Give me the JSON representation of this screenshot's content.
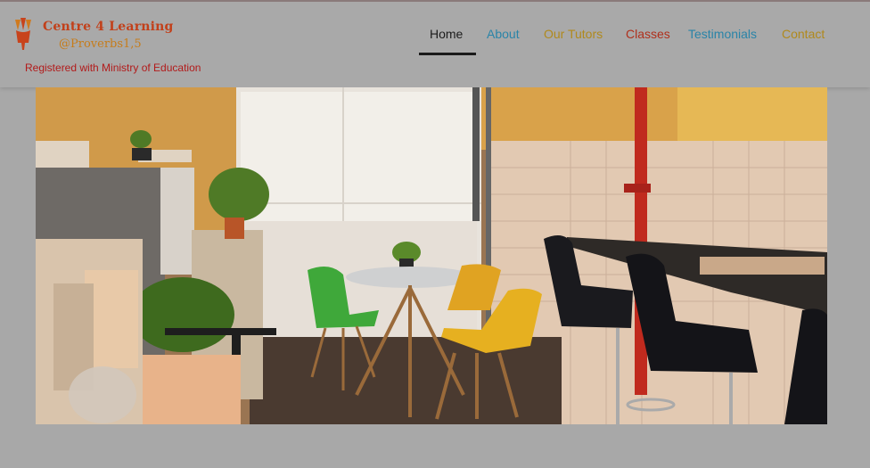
{
  "brand": {
    "name": "Centre 4 Learning",
    "tagline": "@Proverbs1,5",
    "registration": "Registered with Ministry of Education",
    "logo_icon": "hand-pencils-logo-icon"
  },
  "nav": {
    "items": [
      {
        "label": "Home",
        "active": true,
        "color": "#1c1c1c"
      },
      {
        "label": "About",
        "active": false,
        "color": "#2a84a8"
      },
      {
        "label": "Our Tutors",
        "active": false,
        "color": "#b0891c"
      },
      {
        "label": "Classes",
        "active": false,
        "color": "#b0301c"
      },
      {
        "label": "Testimonials",
        "active": false,
        "color": "#2a84a8"
      },
      {
        "label": "Contact",
        "active": false,
        "color": "#b0891c"
      }
    ]
  },
  "colors": {
    "overlay": "#a8a8a8",
    "accent_red": "#b21a1a",
    "accent_orange": "#c2401a"
  }
}
